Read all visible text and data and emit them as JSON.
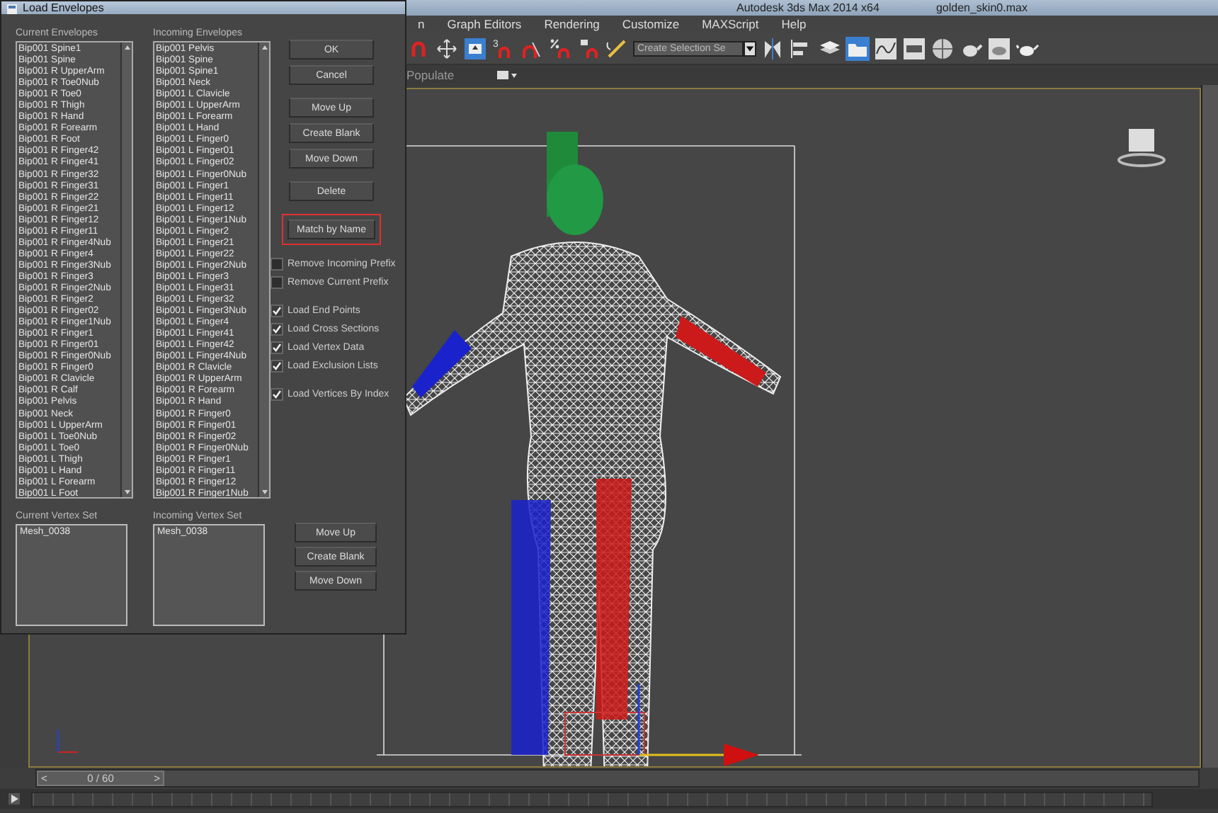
{
  "app": {
    "title": "Autodesk 3ds Max  2014 x64",
    "file": "golden_skin0.max",
    "menu": [
      "n",
      "Graph Editors",
      "Rendering",
      "Customize",
      "MAXScript",
      "Help"
    ],
    "snap_label": "3",
    "selection_set": {
      "placeholder": "Create Selection Se"
    },
    "ribbon_label": "Populate",
    "timeline": {
      "prev": "<",
      "position": "0 / 60",
      "next": ">"
    }
  },
  "dialog": {
    "title": "Load Envelopes",
    "current_label": "Current Envelopes",
    "current": [
      "Bip001 Spine1",
      "Bip001 Spine",
      "Bip001 R UpperArm",
      "Bip001 R Toe0Nub",
      "Bip001 R Toe0",
      "Bip001 R Thigh",
      "Bip001 R Hand",
      "Bip001 R Forearm",
      "Bip001 R Foot",
      "Bip001 R Finger42",
      "Bip001 R Finger41",
      "Bip001 R Finger32",
      "Bip001 R Finger31",
      "Bip001 R Finger22",
      "Bip001 R Finger21",
      "Bip001 R Finger12",
      "Bip001 R Finger11",
      "Bip001 R Finger4Nub",
      "Bip001 R Finger4",
      "Bip001 R Finger3Nub",
      "Bip001 R Finger3",
      "Bip001 R Finger2Nub",
      "Bip001 R Finger2",
      "Bip001 R Finger02",
      "Bip001 R Finger1Nub",
      "Bip001 R Finger1",
      "Bip001 R Finger01",
      "Bip001 R Finger0Nub",
      "Bip001 R Finger0",
      "Bip001 R Clavicle",
      "Bip001 R Calf",
      "Bip001 Pelvis",
      "Bip001 Neck",
      "Bip001 L UpperArm",
      "Bip001 L Toe0Nub",
      "Bip001 L Toe0",
      "Bip001 L Thigh",
      "Bip001 L Hand",
      "Bip001 L Forearm",
      "Bip001 L Foot"
    ],
    "incoming_label": "Incoming Envelopes",
    "incoming": [
      "Bip001 Pelvis",
      "Bip001 Spine",
      "Bip001 Spine1",
      "Bip001 Neck",
      "Bip001 L Clavicle",
      "Bip001 L UpperArm",
      "Bip001 L Forearm",
      "Bip001 L Hand",
      "Bip001 L Finger0",
      "Bip001 L Finger01",
      "Bip001 L Finger02",
      "Bip001 L Finger0Nub",
      "Bip001 L Finger1",
      "Bip001 L Finger11",
      "Bip001 L Finger12",
      "Bip001 L Finger1Nub",
      "Bip001 L Finger2",
      "Bip001 L Finger21",
      "Bip001 L Finger22",
      "Bip001 L Finger2Nub",
      "Bip001 L Finger3",
      "Bip001 L Finger31",
      "Bip001 L Finger32",
      "Bip001 L Finger3Nub",
      "Bip001 L Finger4",
      "Bip001 L Finger41",
      "Bip001 L Finger42",
      "Bip001 L Finger4Nub",
      "Bip001 R Clavicle",
      "Bip001 R UpperArm",
      "Bip001 R Forearm",
      "Bip001 R Hand",
      "Bip001 R Finger0",
      "Bip001 R Finger01",
      "Bip001 R Finger02",
      "Bip001 R Finger0Nub",
      "Bip001 R Finger1",
      "Bip001 R Finger11",
      "Bip001 R Finger12",
      "Bip001 R Finger1Nub"
    ],
    "button_groups": [
      [
        {
          "label": "OK",
          "highlighted": false
        },
        {
          "label": "Cancel",
          "highlighted": false
        }
      ],
      [
        {
          "label": "Move Up",
          "highlighted": false
        },
        {
          "label": "Create Blank",
          "highlighted": false
        },
        {
          "label": "Move Down",
          "highlighted": false
        }
      ],
      [
        {
          "label": "Delete",
          "highlighted": false
        }
      ],
      [
        {
          "label": "Match by Name",
          "highlighted": true
        }
      ]
    ],
    "option_groups": [
      [
        {
          "label": "Remove Incoming Prefix",
          "checked": false
        },
        {
          "label": "Remove Current Prefix",
          "checked": false
        }
      ],
      [
        {
          "label": "Load End Points",
          "checked": true
        },
        {
          "label": "Load Cross Sections",
          "checked": true
        },
        {
          "label": "Load Vertex Data",
          "checked": true
        },
        {
          "label": "Load Exclusion Lists",
          "checked": true
        }
      ],
      [
        {
          "label": "Load Vertices By Index",
          "checked": true
        }
      ]
    ],
    "vertex": {
      "current_label": "Current Vertex Set",
      "current": [
        "Mesh_0038"
      ],
      "incoming_label": "Incoming Vertex Set",
      "incoming": [
        "Mesh_0038"
      ],
      "buttons": [
        "Move Up",
        "Create Blank",
        "Move Down"
      ]
    }
  }
}
